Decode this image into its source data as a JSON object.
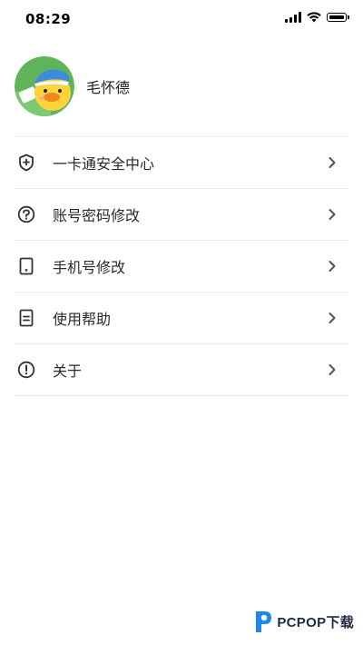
{
  "status_bar": {
    "time": "08:29"
  },
  "profile": {
    "username": "毛怀德",
    "avatar_icon": "duck-avatar-icon"
  },
  "menu": {
    "items": [
      {
        "label": "一卡通安全中心",
        "icon": "shield-plus-icon"
      },
      {
        "label": "账号密码修改",
        "icon": "key-circle-icon"
      },
      {
        "label": "手机号修改",
        "icon": "phone-icon"
      },
      {
        "label": "使用帮助",
        "icon": "document-icon"
      },
      {
        "label": "关于",
        "icon": "info-circle-icon"
      }
    ]
  },
  "watermark": {
    "text": "PCPOP下载"
  },
  "colors": {
    "background": "#ffffff",
    "divider": "#ebebeb",
    "text": "#222222",
    "icon": "#333333",
    "chevron": "#555555"
  }
}
